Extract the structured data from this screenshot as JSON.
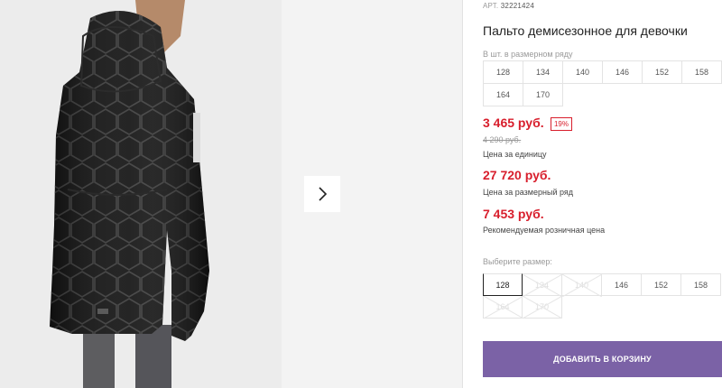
{
  "product": {
    "article_label": "АРТ.",
    "article_value": "32221424",
    "title": "Пальто демисезонное для девочки"
  },
  "size_range": {
    "hint": "В шт. в размерном ряду",
    "sizes": [
      "128",
      "134",
      "140",
      "146",
      "152",
      "158",
      "164",
      "170"
    ]
  },
  "pricing": {
    "unit_price": "3 465 руб.",
    "discount_badge": "19%",
    "old_price": "4 290 руб.",
    "unit_label": "Цена за единицу",
    "range_price": "27 720 руб.",
    "range_label": "Цена за размерный ряд",
    "retail_price": "7 453 руб.",
    "retail_label": "Рекомендуемая розничная цена"
  },
  "size_select": {
    "label": "Выберите размер:",
    "options": [
      {
        "value": "128",
        "state": "selected"
      },
      {
        "value": "134",
        "state": "disabled"
      },
      {
        "value": "140",
        "state": "disabled"
      },
      {
        "value": "146",
        "state": "available"
      },
      {
        "value": "152",
        "state": "available"
      },
      {
        "value": "158",
        "state": "available"
      },
      {
        "value": "164",
        "state": "disabled"
      },
      {
        "value": "170",
        "state": "disabled"
      }
    ]
  },
  "cart": {
    "button_label": "ДОБАВИТЬ В КОРЗИНУ"
  },
  "gallery": {
    "next_icon": "chevron-right-icon"
  },
  "colors": {
    "price": "#d81e2c",
    "button": "#7b62a6"
  }
}
